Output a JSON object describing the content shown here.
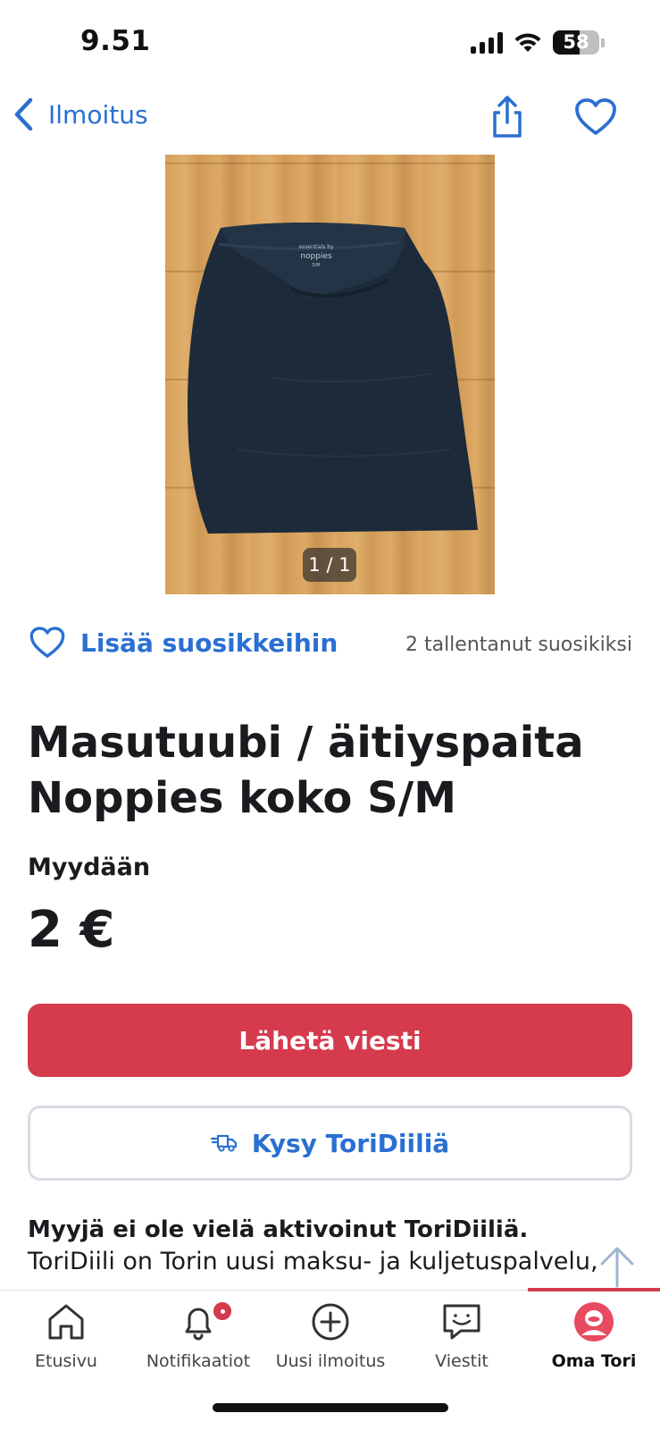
{
  "status_bar": {
    "time": "9.51",
    "battery": "58",
    "battery_level": 0.58
  },
  "nav": {
    "back_label": "Ilmoitus"
  },
  "image": {
    "counter": "1 / 1",
    "brand_print_top": "essentials by",
    "brand_print": "noppies",
    "size_print": "S/M"
  },
  "favorites": {
    "add_label": "Lisää suosikkeihin",
    "saved_count": "2 tallentanut suosikiksi"
  },
  "listing": {
    "title": "Masutuubi / äitiyspaita Noppies koko S/M",
    "sale_type": "Myydään",
    "price": "2 €"
  },
  "actions": {
    "send_message": "Lähetä viesti",
    "ask_deal": "Kysy ToriDiiliä"
  },
  "seller_info": {
    "heading": "Myyjä ei ole vielä aktivoinut ToriDiiliä.",
    "text": "ToriDiili on Torin uusi maksu- ja kuljetuspalvelu, jolla katiutat torilöydöt"
  },
  "tabs": [
    {
      "label": "Etusivu",
      "icon": "home-icon"
    },
    {
      "label": "Notifikaatiot",
      "icon": "bell-icon"
    },
    {
      "label": "Uusi ilmoitus",
      "icon": "plus-circle-icon"
    },
    {
      "label": "Viestit",
      "icon": "chat-icon"
    },
    {
      "label": "Oma Tori",
      "icon": "avatar-icon"
    }
  ],
  "colors": {
    "accent_blue": "#2a6fd2",
    "brand_red": "#d53a4d",
    "text": "#1b1b1f"
  }
}
